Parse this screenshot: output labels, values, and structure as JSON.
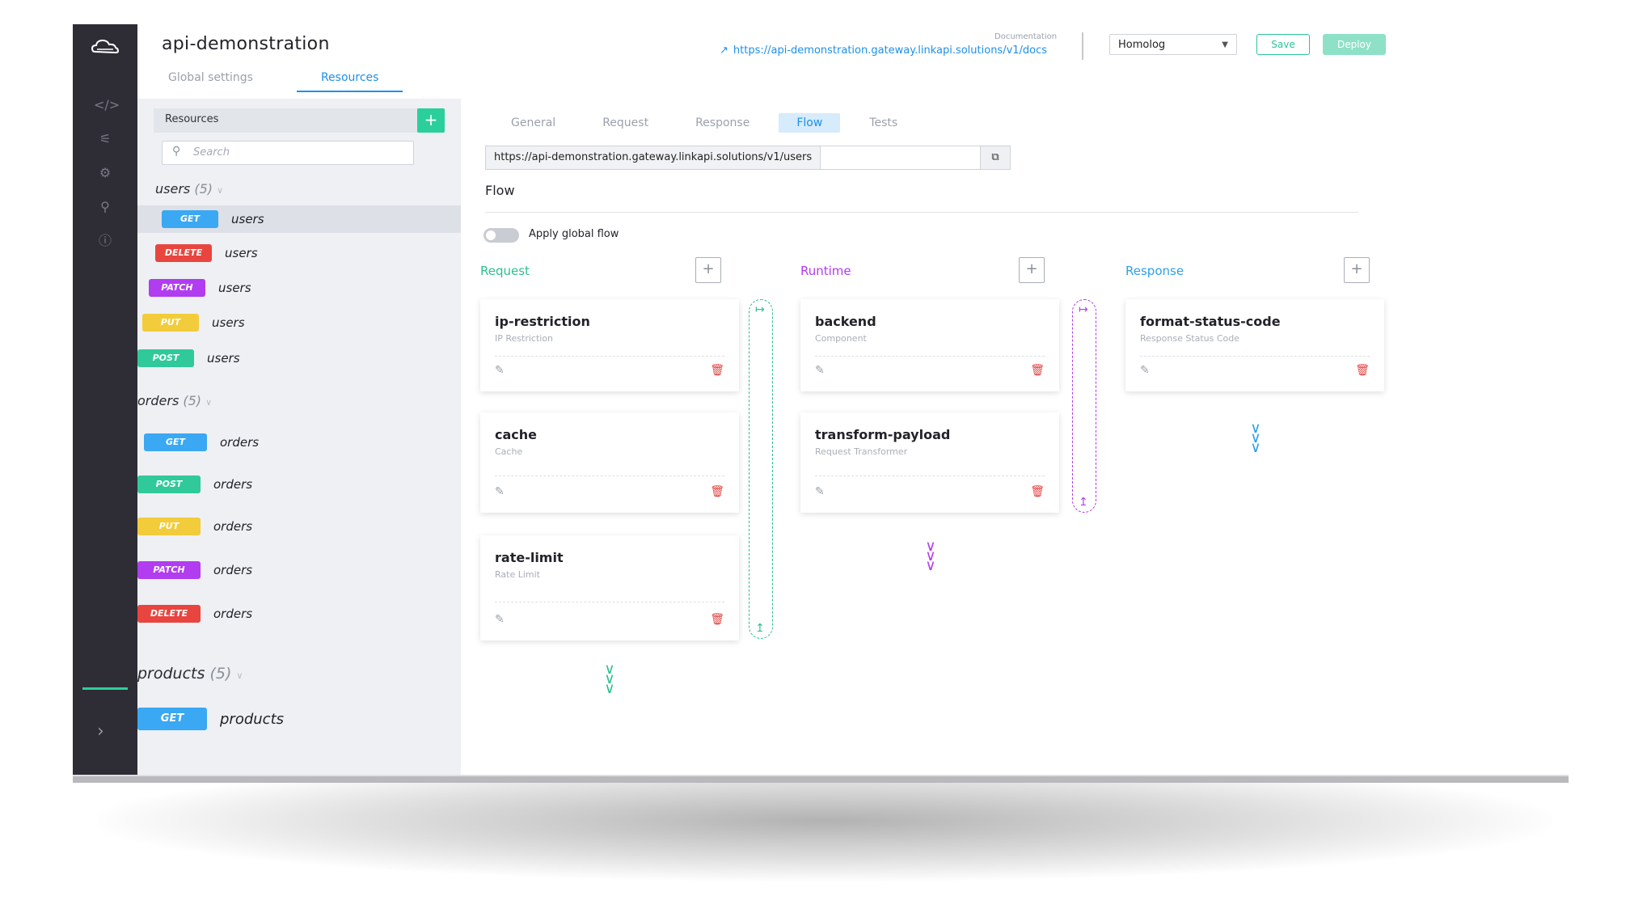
{
  "app": {
    "title": "api-demonstration",
    "doc_label": "Documentation",
    "doc_link": "https://api-demonstration.gateway.linkapi.solutions/v1/docs",
    "environment": "Homolog",
    "save_label": "Save",
    "deploy_label": "Deploy"
  },
  "top_tabs": [
    {
      "label": "Global settings",
      "active": false
    },
    {
      "label": "Resources",
      "active": true
    }
  ],
  "sidebar_icons": [
    "cloud-logo-icon",
    "code-icon",
    "plug-icon",
    "gear-icon",
    "key-icon",
    "help-icon",
    "chevron-right-icon"
  ],
  "resources": {
    "title": "Resources",
    "add_label": "+",
    "search_placeholder": "Search",
    "groups": [
      {
        "name": "users",
        "count": "(5)",
        "items": [
          {
            "method": "GET",
            "name": "users",
            "selected": true
          },
          {
            "method": "DELETE",
            "name": "users"
          },
          {
            "method": "PATCH",
            "name": "users"
          },
          {
            "method": "PUT",
            "name": "users"
          },
          {
            "method": "POST",
            "name": "users"
          }
        ]
      },
      {
        "name": "orders",
        "count": "(5)",
        "items": [
          {
            "method": "GET",
            "name": "orders"
          },
          {
            "method": "POST",
            "name": "orders"
          },
          {
            "method": "PUT",
            "name": "orders"
          },
          {
            "method": "PATCH",
            "name": "orders"
          },
          {
            "method": "DELETE",
            "name": "orders"
          }
        ]
      },
      {
        "name": "products",
        "count": "(5)",
        "items": [
          {
            "method": "GET",
            "name": "products"
          }
        ]
      }
    ]
  },
  "method_colors": {
    "GET": "#3aa8f2",
    "POST": "#2fc99a",
    "PUT": "#f2cc3a",
    "PATCH": "#b13cf0",
    "DELETE": "#e8453f"
  },
  "sub_tabs": [
    {
      "label": "General",
      "active": false
    },
    {
      "label": "Request",
      "active": false
    },
    {
      "label": "Response",
      "active": false
    },
    {
      "label": "Flow",
      "active": true
    },
    {
      "label": "Tests",
      "active": false
    }
  ],
  "endpoint_url": "https://api-demonstration.gateway.linkapi.solutions/v1/users",
  "flow": {
    "title": "Flow",
    "toggle_label": "Apply global flow",
    "toggle_on": false,
    "columns": [
      {
        "title": "Request",
        "color": "#2bbf8e",
        "cards": [
          {
            "name": "ip-restriction",
            "type": "IP Restriction"
          },
          {
            "name": "cache",
            "type": "Cache"
          },
          {
            "name": "rate-limit",
            "type": "Rate Limit"
          }
        ]
      },
      {
        "title": "Runtime",
        "color": "#b13cf0",
        "cards": [
          {
            "name": "backend",
            "type": "Component"
          },
          {
            "name": "transform-payload",
            "type": "Request Transformer"
          }
        ]
      },
      {
        "title": "Response",
        "color": "#2f9fe6",
        "cards": [
          {
            "name": "format-status-code",
            "type": "Response Status Code"
          }
        ]
      }
    ]
  }
}
